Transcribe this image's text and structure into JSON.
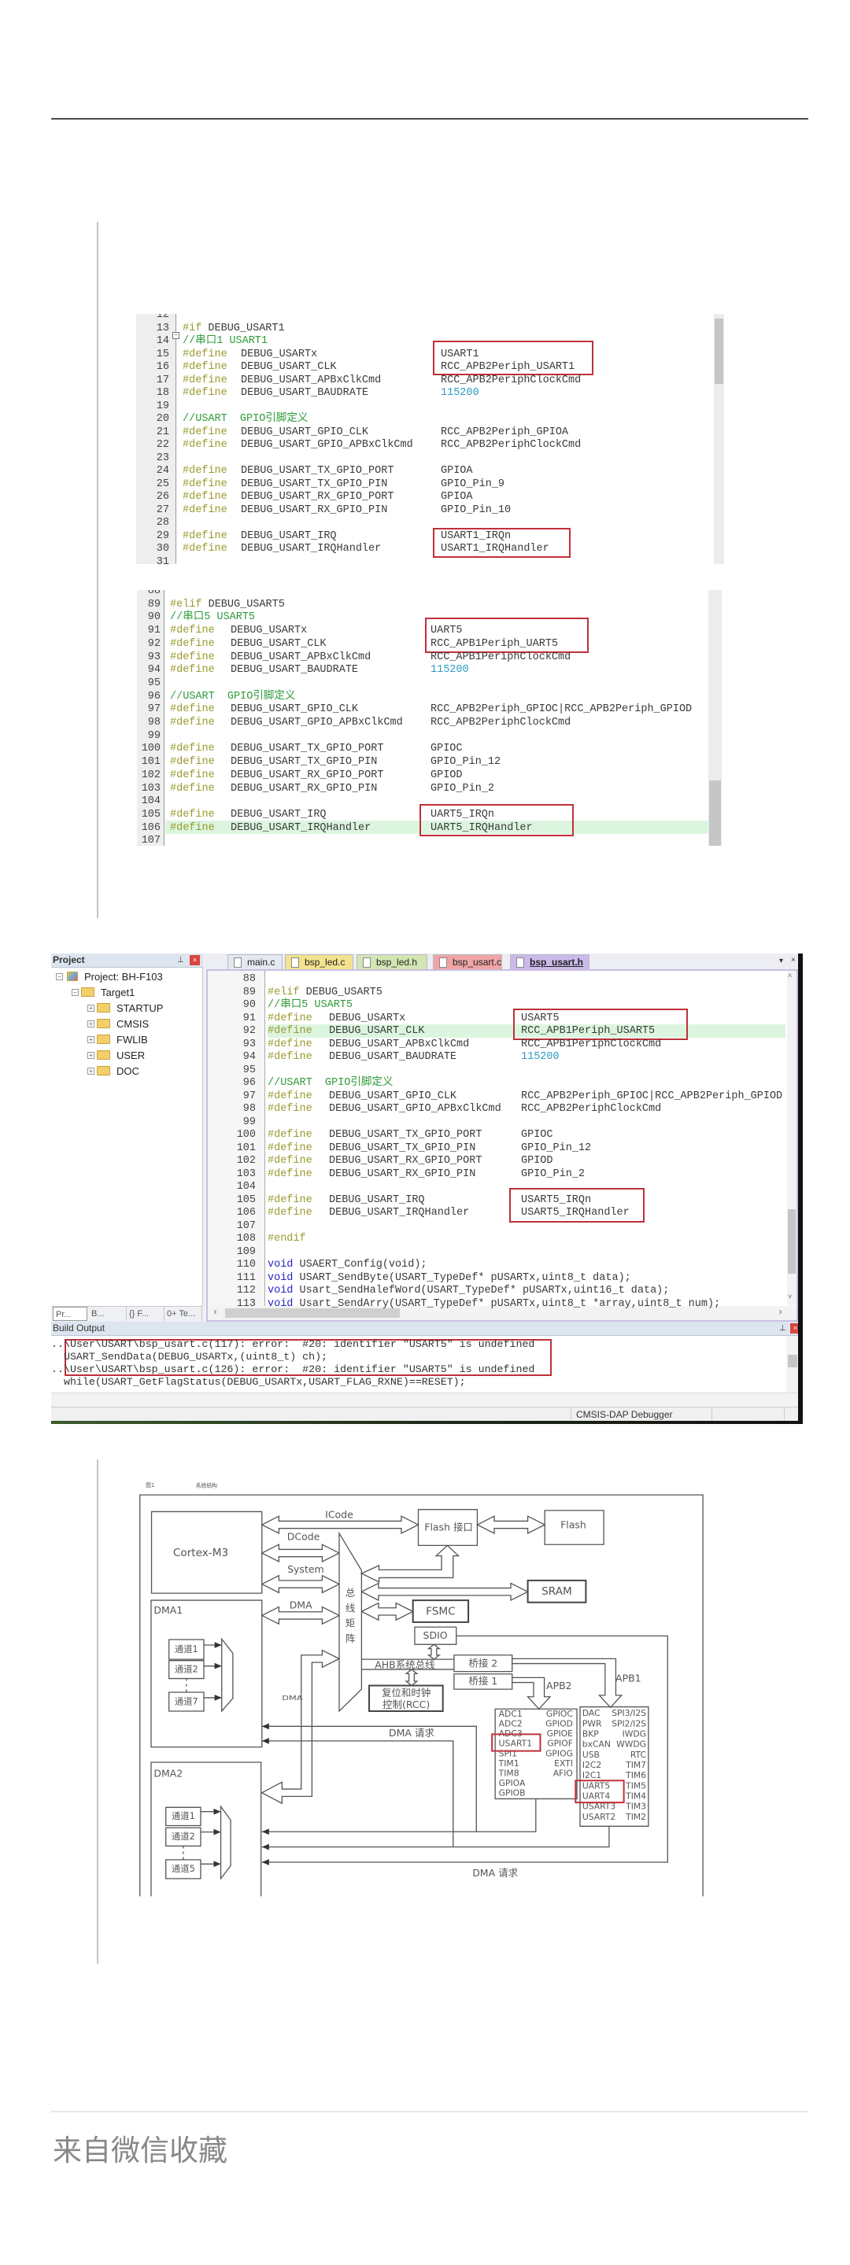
{
  "article": {
    "footer_source": "来自微信收藏"
  },
  "code_usart1": [
    {
      "n": "12"
    },
    {
      "n": "13",
      "kw": "#if",
      "name": "DEBUG_USART1"
    },
    {
      "n": "14",
      "comment": "//串口1 USART1"
    },
    {
      "n": "15",
      "kw": "#define",
      "name": "DEBUG_USARTx",
      "val": "USART1"
    },
    {
      "n": "16",
      "kw": "#define",
      "name": "DEBUG_USART_CLK",
      "val": "RCC_APB2Periph_USART1"
    },
    {
      "n": "17",
      "kw": "#define",
      "name": "DEBUG_USART_APBxClkCmd",
      "val": "RCC_APB2PeriphClockCmd"
    },
    {
      "n": "18",
      "kw": "#define",
      "name": "DEBUG_USART_BAUDRATE",
      "val": "115200"
    },
    {
      "n": "19"
    },
    {
      "n": "20",
      "comment": "//USART  GPIO引脚定义"
    },
    {
      "n": "21",
      "kw": "#define",
      "name": "DEBUG_USART_GPIO_CLK",
      "val": "RCC_APB2Periph_GPIOA"
    },
    {
      "n": "22",
      "kw": "#define",
      "name": "DEBUG_USART_GPIO_APBxClkCmd",
      "val": "RCC_APB2PeriphClockCmd"
    },
    {
      "n": "23"
    },
    {
      "n": "24",
      "kw": "#define",
      "name": "DEBUG_USART_TX_GPIO_PORT",
      "val": "GPIOA"
    },
    {
      "n": "25",
      "kw": "#define",
      "name": "DEBUG_USART_TX_GPIO_PIN",
      "val": "GPIO_Pin_9"
    },
    {
      "n": "26",
      "kw": "#define",
      "name": "DEBUG_USART_RX_GPIO_PORT",
      "val": "GPIOA"
    },
    {
      "n": "27",
      "kw": "#define",
      "name": "DEBUG_USART_RX_GPIO_PIN",
      "val": "GPIO_Pin_10"
    },
    {
      "n": "28"
    },
    {
      "n": "29",
      "kw": "#define",
      "name": "DEBUG_USART_IRQ",
      "val": "USART1_IRQn"
    },
    {
      "n": "30",
      "kw": "#define",
      "name": "DEBUG_USART_IRQHandler",
      "val": "USART1_IRQHandler"
    },
    {
      "n": "31"
    }
  ],
  "code_uart5": [
    {
      "n": "88"
    },
    {
      "n": "89",
      "kw": "#elif",
      "name": "DEBUG_USART5"
    },
    {
      "n": "90",
      "comment": "//串口5 USART5"
    },
    {
      "n": "91",
      "kw": "#define",
      "name": "DEBUG_USARTx",
      "val": "UART5"
    },
    {
      "n": "92",
      "kw": "#define",
      "name": "DEBUG_USART_CLK",
      "val": "RCC_APB1Periph_UART5"
    },
    {
      "n": "93",
      "kw": "#define",
      "name": "DEBUG_USART_APBxClkCmd",
      "val": "RCC_APB1PeriphClockCmd"
    },
    {
      "n": "94",
      "kw": "#define",
      "name": "DEBUG_USART_BAUDRATE",
      "val": "115200"
    },
    {
      "n": "95"
    },
    {
      "n": "96",
      "comment": "//USART  GPIO引脚定义"
    },
    {
      "n": "97",
      "kw": "#define",
      "name": "DEBUG_USART_GPIO_CLK",
      "val": "RCC_APB2Periph_GPIOC|RCC_APB2Periph_GPIOD"
    },
    {
      "n": "98",
      "kw": "#define",
      "name": "DEBUG_USART_GPIO_APBxClkCmd",
      "val": "RCC_APB2PeriphClockCmd"
    },
    {
      "n": "99"
    },
    {
      "n": "100",
      "kw": "#define",
      "name": "DEBUG_USART_TX_GPIO_PORT",
      "val": "GPIOC"
    },
    {
      "n": "101",
      "kw": "#define",
      "name": "DEBUG_USART_TX_GPIO_PIN",
      "val": "GPIO_Pin_12"
    },
    {
      "n": "102",
      "kw": "#define",
      "name": "DEBUG_USART_RX_GPIO_PORT",
      "val": "GPIOD"
    },
    {
      "n": "103",
      "kw": "#define",
      "name": "DEBUG_USART_RX_GPIO_PIN",
      "val": "GPIO_Pin_2"
    },
    {
      "n": "104"
    },
    {
      "n": "105",
      "kw": "#define",
      "name": "DEBUG_USART_IRQ",
      "val": "UART5_IRQn"
    },
    {
      "n": "106",
      "kw": "#define",
      "name": "DEBUG_USART_IRQHandler",
      "val": "UART5_IRQHandler"
    },
    {
      "n": "107"
    }
  ],
  "ide": {
    "project_panel_title": "Project",
    "tree": [
      {
        "label": "Project: BH-F103"
      },
      {
        "label": "Target1"
      },
      {
        "label": "STARTUP"
      },
      {
        "label": "CMSIS"
      },
      {
        "label": "FWLIB"
      },
      {
        "label": "USER"
      },
      {
        "label": "DOC"
      }
    ],
    "panel_tabs": [
      "Pr...",
      "B...",
      "{} F...",
      "0+ Te..."
    ],
    "tabs": [
      {
        "label": "main.c",
        "color": "#e4e8f0"
      },
      {
        "label": "bsp_led.c",
        "color": "#f3e28e"
      },
      {
        "label": "bsp_led.h",
        "color": "#d3e5b3"
      },
      {
        "label": "bsp_usart.c",
        "color": "#f0a4a4"
      },
      {
        "label": "bsp_usart.h",
        "color": "#cbb9ea",
        "active": true
      }
    ],
    "code": [
      {
        "n": "88"
      },
      {
        "n": "89",
        "kw": "#elif",
        "name": "DEBUG_USART5"
      },
      {
        "n": "90",
        "comment": "//串口5 USART5"
      },
      {
        "n": "91",
        "kw": "#define",
        "name": "DEBUG_USARTx",
        "val": "USART5"
      },
      {
        "n": "92",
        "kw": "#define",
        "name": "DEBUG_USART_CLK",
        "val": "RCC_APB1Periph_USART5"
      },
      {
        "n": "93",
        "kw": "#define",
        "name": "DEBUG_USART_APBxClkCmd",
        "val": "RCC_APB1PeriphClockCmd"
      },
      {
        "n": "94",
        "kw": "#define",
        "name": "DEBUG_USART_BAUDRATE",
        "val": "115200"
      },
      {
        "n": "95"
      },
      {
        "n": "96",
        "comment": "//USART  GPIO引脚定义"
      },
      {
        "n": "97",
        "kw": "#define",
        "name": "DEBUG_USART_GPIO_CLK",
        "val": "RCC_APB2Periph_GPIOC|RCC_APB2Periph_GPIOD"
      },
      {
        "n": "98",
        "kw": "#define",
        "name": "DEBUG_USART_GPIO_APBxClkCmd",
        "val": "RCC_APB2PeriphClockCmd"
      },
      {
        "n": "99"
      },
      {
        "n": "100",
        "kw": "#define",
        "name": "DEBUG_USART_TX_GPIO_PORT",
        "val": "GPIOC"
      },
      {
        "n": "101",
        "kw": "#define",
        "name": "DEBUG_USART_TX_GPIO_PIN",
        "val": "GPIO_Pin_12"
      },
      {
        "n": "102",
        "kw": "#define",
        "name": "DEBUG_USART_RX_GPIO_PORT",
        "val": "GPIOD"
      },
      {
        "n": "103",
        "kw": "#define",
        "name": "DEBUG_USART_RX_GPIO_PIN",
        "val": "GPIO_Pin_2"
      },
      {
        "n": "104"
      },
      {
        "n": "105",
        "kw": "#define",
        "name": "DEBUG_USART_IRQ",
        "val": "USART5_IRQn"
      },
      {
        "n": "106",
        "kw": "#define",
        "name": "DEBUG_USART_IRQHandler",
        "val": "USART5_IRQHandler"
      },
      {
        "n": "107"
      },
      {
        "n": "108",
        "kw": "#endif"
      },
      {
        "n": "109"
      },
      {
        "n": "110",
        "kw": "void",
        "name": "USAERT_Config(void);"
      },
      {
        "n": "111",
        "kw": "void",
        "name": "USART_SendByte(USART_TypeDef* pUSARTx,uint8_t data);"
      },
      {
        "n": "112",
        "kw": "void",
        "name": "Usart_SendHalefWord(USART_TypeDef* pUSARTx,uint16_t data);"
      },
      {
        "n": "113",
        "kw": "void",
        "name": "Usart_SendArry(USART_TypeDef* pUSARTx,uint8_t *array,uint8_t num);"
      }
    ],
    "build_output_title": "Build Output",
    "build_output": [
      "..\\User\\USART\\bsp_usart.c(117): error:  #20: identifier \"USART5\" is undefined",
      "  USART_SendData(DEBUG_USARTx,(uint8_t) ch);",
      "..\\User\\USART\\bsp_usart.c(126): error:  #20: identifier \"USART5\" is undefined",
      "  while(USART_GetFlagStatus(DEBUG_USARTx,USART_FLAG_RXNE)==RESET);"
    ],
    "status_debugger": "CMSIS-DAP Debugger"
  },
  "diagram": {
    "caption_fig": "图1",
    "caption_title": "系统结构",
    "cortex": "Cortex-M3",
    "icode": "ICode",
    "dcode": "DCode",
    "system": "System",
    "dma_bus": "DMA",
    "flash_if": "Flash 接口",
    "flash": "Flash",
    "sram": "SRAM",
    "fsmc": "FSMC",
    "sdio": "SDIO",
    "bus_matrix": [
      "总",
      "线",
      "矩",
      "阵"
    ],
    "ahb": "AHB系统总线",
    "bridge2": "桥接 2",
    "bridge1": "桥接 1",
    "rcc_line1": "复位和时钟",
    "rcc_line2": "控制(RCC)",
    "apb2": "APB2",
    "apb1": "APB1",
    "dma1": "DMA1",
    "dma2": "DMA2",
    "dma1_channels": [
      "通道1",
      "通道2",
      "通道7"
    ],
    "dma2_channels": [
      "通道1",
      "通道2",
      "通道5"
    ],
    "dma_vertical": "DMA",
    "dma_request_1": "DMA 请求",
    "dma_request_2": "DMA 请求",
    "apb2_left": [
      "ADC1",
      "ADC2",
      "ADC3",
      "USART1",
      "SPI1",
      "TIM1",
      "TIM8",
      "GPIOA",
      "GPIOB"
    ],
    "apb2_right": [
      "GPIOC",
      "GPIOD",
      "GPIOE",
      "GPIOF",
      "GPIOG",
      "EXTI",
      "AFIO"
    ],
    "apb1_left": [
      "DAC",
      "PWR",
      "BKP",
      "bxCAN",
      "USB",
      "I2C2",
      "I2C1",
      "UART5",
      "UART4",
      "USART3",
      "USART2"
    ],
    "apb1_right": [
      "SPI3/I2S",
      "SPI2/I2S",
      "IWDG",
      "WWDG",
      "RTC",
      "TIM7",
      "TIM6",
      "TIM5",
      "TIM4",
      "TIM3",
      "TIM2"
    ]
  },
  "colors": {
    "highlight_box": "#c0303a",
    "comment": "#2f9a3a",
    "keyword": "#9a9a2e"
  }
}
